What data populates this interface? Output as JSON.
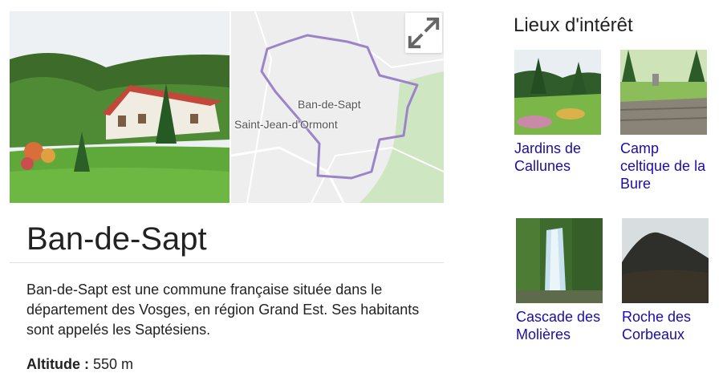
{
  "place": {
    "title": "Ban-de-Sapt",
    "description": "Ban-de-Sapt est une commune française située dans le département des Vosges, en région Grand Est. Ses habitants sont appelés les Saptésiens.",
    "facts": [
      {
        "label": "Altitude :",
        "value": "550 m"
      }
    ]
  },
  "map": {
    "town_label": "Ban-de-Sapt",
    "neighbor_label": "Saint-Jean-d'Ormont",
    "expand_icon": "expand-arrows-icon",
    "boundary_color": "#9c84c8"
  },
  "poi": {
    "heading": "Lieux d'intérêt",
    "items": [
      {
        "name": "Jardins de Callunes"
      },
      {
        "name": "Camp celtique de la Bure"
      },
      {
        "name": "Cascade des Molières"
      },
      {
        "name": "Roche des Corbeaux"
      }
    ]
  },
  "colors": {
    "link": "#1a0dab",
    "text": "#222222",
    "divider": "#e0e0e0"
  }
}
